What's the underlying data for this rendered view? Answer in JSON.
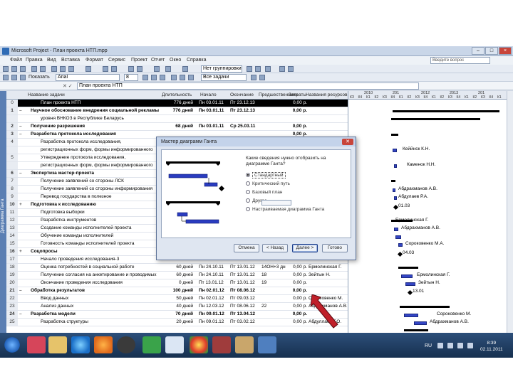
{
  "window": {
    "title": "Microsoft Project - План проекта НТП.mpp",
    "buttons": [
      "–",
      "□",
      "×"
    ]
  },
  "menu": {
    "items": [
      "Файл",
      "Правка",
      "Вид",
      "Вставка",
      "Формат",
      "Сервис",
      "Проект",
      "Отчет",
      "Окно",
      "Справка"
    ],
    "help_placeholder": "Введите вопрос"
  },
  "toolbar1": {
    "group_field": "Нет группировки"
  },
  "toolbar2": {
    "show_label": "Показать",
    "font_field": "Arial",
    "size_field": "8",
    "filter_field": "Все задачи"
  },
  "entry_bar": {
    "value": "План проекта НТП"
  },
  "view_bar": {
    "label": "Диаграмма Ганта"
  },
  "grid": {
    "headers": {
      "name": "Название задачи",
      "duration": "Длительность",
      "start": "Начало",
      "finish": "Окончание",
      "pred": "Предшественники",
      "cost": "Затраты",
      "resources": "Названия ресурсов"
    },
    "rows": [
      {
        "n": "0",
        "ind": "",
        "name": "План проекта НТП",
        "dur": "776 дней",
        "start": "Пн 03.01.11",
        "finish": "Пт 23.12.13",
        "pred": "",
        "cost": "0,00 р.",
        "res": ""
      },
      {
        "n": "1",
        "ind": "–",
        "name": "Научное обоснование внедрения социальной рекламы",
        "dur": "776 дней",
        "start": "Пн 03.01.11",
        "finish": "Пт 23.12.13",
        "pred": "",
        "cost": "0,00 р.",
        "res": ""
      },
      {
        "n": "",
        "ind": "",
        "name": "уровня ВНКОЗ в Республике Беларусь",
        "dur": "",
        "start": "",
        "finish": "",
        "pred": "",
        "cost": "",
        "res": ""
      },
      {
        "n": "2",
        "ind": "–",
        "name": "Получение разрешения",
        "dur": "68 дней",
        "start": "Пн 03.01.11",
        "finish": "Ср 25.03.11",
        "pred": "",
        "cost": "0,00 р.",
        "res": ""
      },
      {
        "n": "3",
        "ind": "–",
        "name": "Разработка протокола исследования",
        "dur": "",
        "start": "",
        "finish": "",
        "pred": "",
        "cost": "0,00 р.",
        "res": ""
      },
      {
        "n": "4",
        "ind": "",
        "name": "Разработка протокола исследования,",
        "dur": "",
        "start": "",
        "finish": "",
        "pred": "",
        "cost": "0,00 р.",
        "res": ""
      },
      {
        "n": "",
        "ind": "",
        "name": "регистрационных форм, формы информированного",
        "dur": "",
        "start": "",
        "finish": "",
        "pred": "",
        "cost": "",
        "res": ""
      },
      {
        "n": "5",
        "ind": "",
        "name": "Утверждение протокола исследования,",
        "dur": "",
        "start": "",
        "finish": "",
        "pred": "",
        "cost": "0,00 р.",
        "res": ""
      },
      {
        "n": "",
        "ind": "",
        "name": "регистрационных форм, формы информированного",
        "dur": "",
        "start": "",
        "finish": "",
        "pred": "",
        "cost": "",
        "res": ""
      },
      {
        "n": "6",
        "ind": "–",
        "name": "Экспертиза мастер-проекта",
        "dur": "",
        "start": "",
        "finish": "",
        "pred": "",
        "cost": "0,00 р.",
        "res": ""
      },
      {
        "n": "7",
        "ind": "",
        "name": "Получение заявлений со стороны ЛСК",
        "dur": "",
        "start": "",
        "finish": "",
        "pred": "",
        "cost": "",
        "res": ""
      },
      {
        "n": "8",
        "ind": "",
        "name": "Получение заявлений со стороны информирования",
        "dur": "",
        "start": "",
        "finish": "",
        "pred": "",
        "cost": "",
        "res": ""
      },
      {
        "n": "9",
        "ind": "",
        "name": "Перевод государства в полезное",
        "dur": "",
        "start": "",
        "finish": "",
        "pred": "",
        "cost": "",
        "res": ""
      },
      {
        "n": "10",
        "ind": "+",
        "name": "Подготовка к исследованию",
        "dur": "",
        "start": "",
        "finish": "",
        "pred": "",
        "cost": "",
        "res": ""
      },
      {
        "n": "11",
        "ind": "",
        "name": "Подготовка выборки",
        "dur": "",
        "start": "",
        "finish": "",
        "pred": "",
        "cost": "",
        "res": ""
      },
      {
        "n": "12",
        "ind": "",
        "name": "Разработка инструментов",
        "dur": "",
        "start": "",
        "finish": "",
        "pred": "",
        "cost": "",
        "res": ""
      },
      {
        "n": "13",
        "ind": "",
        "name": "Создание команды исполнителей проекта",
        "dur": "",
        "start": "",
        "finish": "",
        "pred": "",
        "cost": "",
        "res": ""
      },
      {
        "n": "14",
        "ind": "",
        "name": "Обучение команды исполнителей",
        "dur": "",
        "start": "",
        "finish": "",
        "pred": "",
        "cost": "",
        "res": ""
      },
      {
        "n": "15",
        "ind": "",
        "name": "Готовность команды исполнителей проекта",
        "dur": "",
        "start": "",
        "finish": "",
        "pred": "",
        "cost": "",
        "res": ""
      },
      {
        "n": "16",
        "ind": "+",
        "name": "Соцопросы",
        "dur": "",
        "start": "",
        "finish": "",
        "pred": "",
        "cost": "",
        "res": ""
      },
      {
        "n": "17",
        "ind": "",
        "name": "Начало проведения исследования-3",
        "dur": "",
        "start": "",
        "finish": "",
        "pred": "",
        "cost": "",
        "res": ""
      },
      {
        "n": "18",
        "ind": "",
        "name": "Оценка потребностей в социальной работе",
        "dur": "60 дней",
        "start": "Пн 24.10.11",
        "finish": "Пт 13.01.12",
        "pred": "14ОН+3 дней",
        "cost": "0,00 р.",
        "res": "Ермолинская Г."
      },
      {
        "n": "19",
        "ind": "",
        "name": "Получение согласия на анкетирование и проводимых",
        "dur": "60 дней",
        "start": "Пн 24.10.11",
        "finish": "Пт 13.01.12",
        "pred": "18",
        "cost": "0,00 р.",
        "res": "Зейтын Н."
      },
      {
        "n": "20",
        "ind": "",
        "name": "Окончание проведения исследования",
        "dur": "0 дней",
        "start": "Пт 13.01.12",
        "finish": "Пт 13.01.12",
        "pred": "19",
        "cost": "0,00 р.",
        "res": ""
      },
      {
        "n": "21",
        "ind": "–",
        "name": "Обработка результатов",
        "dur": "100 дней",
        "start": "Пн 02.01.12",
        "finish": "Пт 08.06.12",
        "pred": "",
        "cost": "0,00 р.",
        "res": ""
      },
      {
        "n": "22",
        "ind": "",
        "name": "Ввод данных",
        "dur": "50 дней",
        "start": "Пн 02.01.12",
        "finish": "Пт 09.03.12",
        "pred": "",
        "cost": "0,00 р.",
        "res": "Сороковенко М."
      },
      {
        "n": "23",
        "ind": "",
        "name": "Анализ данных",
        "dur": "40 дней",
        "start": "Пн 12.03.12",
        "finish": "Пт 08.06.12",
        "pred": "22",
        "cost": "0,00 р.",
        "res": "Абдрахманов А.В."
      },
      {
        "n": "24",
        "ind": "–",
        "name": "Разработка модели",
        "dur": "70 дней",
        "start": "Пн 09.01.12",
        "finish": "Пт 13.04.12",
        "pred": "",
        "cost": "0,00 р.",
        "res": ""
      },
      {
        "n": "25",
        "ind": "",
        "name": "Разработка структуры",
        "dur": "20 дней",
        "start": "Пн 09.01.12",
        "finish": "Пт 03.02.12",
        "pred": "",
        "cost": "0,00 р.",
        "res": "Абдуллаев Г.О."
      }
    ]
  },
  "gantt": {
    "years": [
      "2010",
      "201",
      "2012",
      "2013",
      "201"
    ],
    "quarters": [
      "КЗ",
      "К4",
      "К1",
      "К2",
      "КЗ",
      "К4",
      "К1",
      "К2",
      "КЗ",
      "К4",
      "К1",
      "К2",
      "КЗ",
      "К4",
      "К1",
      "К2",
      "КЗ",
      "К4",
      "К1"
    ],
    "labels": [
      "Кеййнск К.Н.",
      "Каменок Н.Н.",
      "Абдрахманов А.В.",
      "Абдулаев Р.А.",
      "01.03",
      "Ермолинская Г.",
      "Абдрахманов А.В.",
      "Сороковенко М.А.",
      "04.03",
      "Ермолинская Г.",
      "Зейтын Н.",
      "13.01",
      "Сороковенко М.",
      "Абдрахманов А.В.",
      "Абдуллаев Р.А."
    ]
  },
  "dialog": {
    "title": "Мастер диаграмм Ганта",
    "question": "Какие сведения нужно отобразить на диаграмме Ганта?",
    "options": [
      "Стандартный",
      "Критический путь",
      "Базовый план",
      "Другое",
      "Настраиваемая диаграмма Ганта"
    ],
    "buttons": [
      "Отмена",
      "< Назад",
      "Далее >",
      "Готово"
    ]
  },
  "taskbar": {
    "lang": "RU",
    "time": "8:39",
    "date": "02.11.2011"
  },
  "colors": {
    "accent": "#3345c4",
    "arrow": "#c0202a"
  }
}
